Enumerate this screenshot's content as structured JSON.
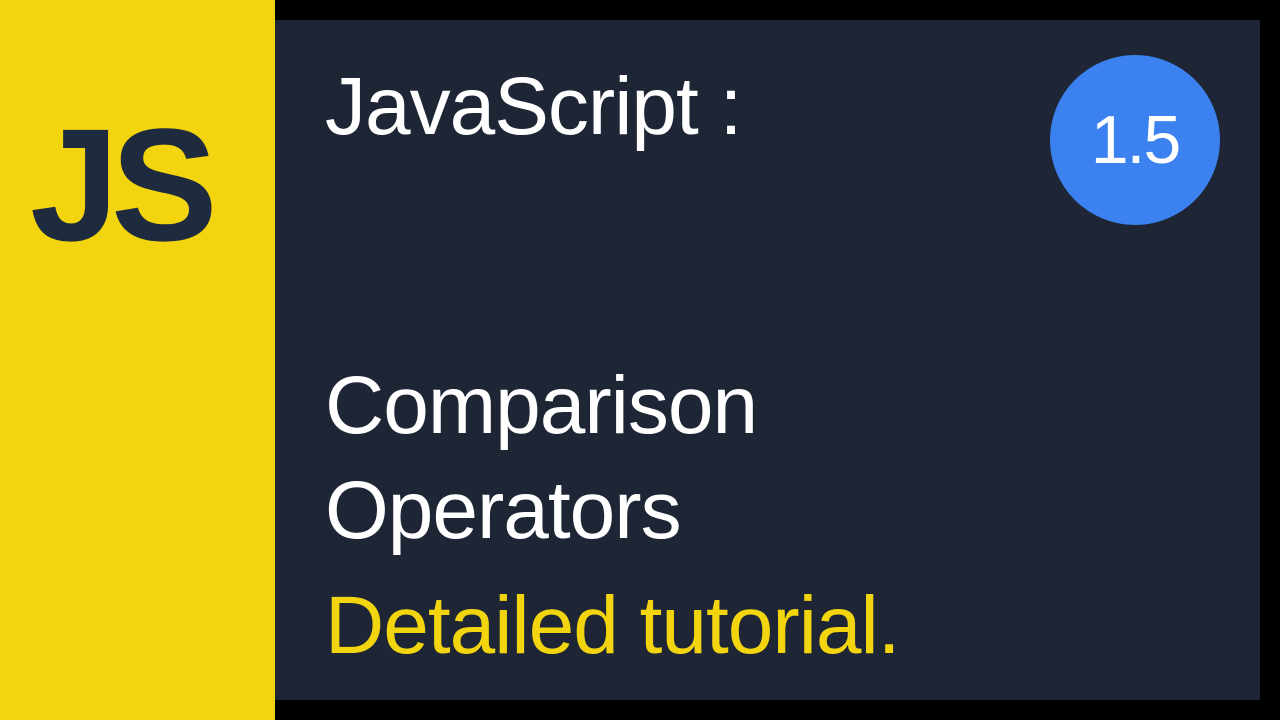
{
  "logo": {
    "text": "JS"
  },
  "header": {
    "title": "JavaScript :",
    "version": "1.5"
  },
  "body": {
    "line1": "Comparison",
    "line2": "Operators",
    "line3": "Detailed tutorial."
  },
  "colors": {
    "yellow": "#f2d50f",
    "dark": "#1e2636",
    "blue": "#3b82f0",
    "white": "#ffffff"
  }
}
